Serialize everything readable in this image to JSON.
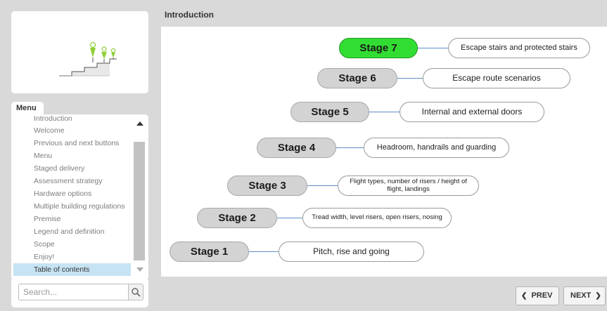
{
  "header": {
    "title": "Introduction"
  },
  "logo": {
    "icon": "stairs-with-people-icon",
    "accent": "#8fcf3a"
  },
  "menu": {
    "tab_label": "Menu",
    "items": [
      {
        "label": "Introduction",
        "active": false
      },
      {
        "label": "Welcome",
        "active": false
      },
      {
        "label": "Previous and next buttons",
        "active": false
      },
      {
        "label": "Menu",
        "active": false
      },
      {
        "label": "Staged delivery",
        "active": false
      },
      {
        "label": "Assessment strategy",
        "active": false
      },
      {
        "label": "Hardware options",
        "active": false
      },
      {
        "label": "Multiple building regulations",
        "active": false
      },
      {
        "label": "Premise",
        "active": false
      },
      {
        "label": "Legend and definition",
        "active": false
      },
      {
        "label": "Scope",
        "active": false
      },
      {
        "label": "Enjoy!",
        "active": false
      },
      {
        "label": "Table of contents",
        "active": true
      }
    ],
    "active_bg": "#c6e3f3"
  },
  "search": {
    "placeholder": "Search...",
    "value": ""
  },
  "stages": [
    {
      "label": "Stage 7",
      "description": "Escape stairs and protected stairs",
      "active": true
    },
    {
      "label": "Stage 6",
      "description": "Escape route scenarios",
      "active": false
    },
    {
      "label": "Stage 5",
      "description": "Internal and external doors",
      "active": false
    },
    {
      "label": "Stage 4",
      "description": "Headroom, handrails and guarding",
      "active": false
    },
    {
      "label": "Stage 3",
      "description": "Flight types, number of risers / height of flight, landings",
      "active": false
    },
    {
      "label": "Stage 2",
      "description": "Tread width, level risers, open risers, nosing",
      "active": false
    },
    {
      "label": "Stage 1",
      "description": "Pitch, rise and going",
      "active": false
    }
  ],
  "colors": {
    "active_stage": "#32dd33",
    "stage": "#d3d3d3",
    "connector": "#5b8ec9"
  },
  "nav": {
    "prev_label": "PREV",
    "prev_icon": "chevron-left-icon",
    "next_label": "NEXT",
    "next_icon": "chevron-right-icon"
  }
}
